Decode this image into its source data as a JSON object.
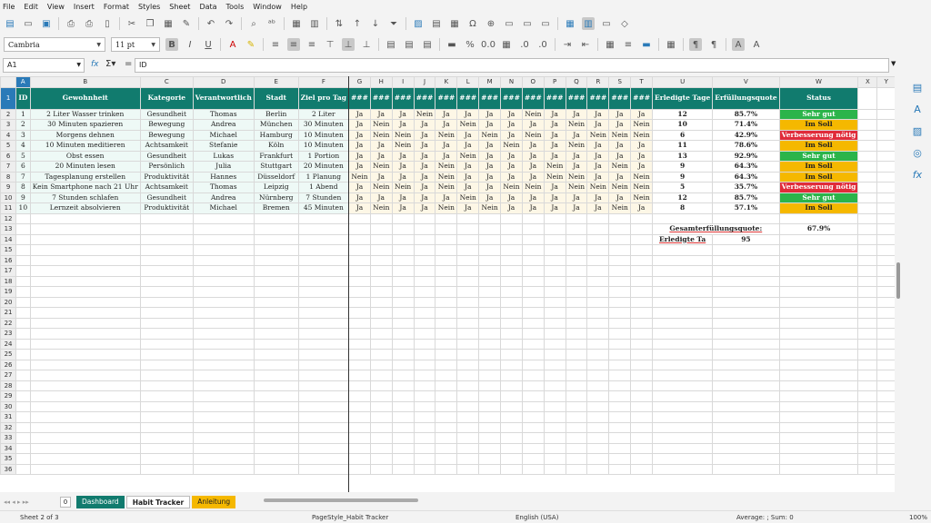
{
  "menu": [
    "File",
    "Edit",
    "View",
    "Insert",
    "Format",
    "Styles",
    "Sheet",
    "Data",
    "Tools",
    "Window",
    "Help"
  ],
  "font_name": "Cambria",
  "font_size": "11 pt",
  "name_box": "A1",
  "formula": "ID",
  "columns": [
    "A",
    "B",
    "C",
    "D",
    "E",
    "F",
    "G",
    "H",
    "I",
    "J",
    "K",
    "L",
    "M",
    "N",
    "O",
    "P",
    "Q",
    "R",
    "S",
    "T",
    "U",
    "V",
    "W",
    "X",
    "Y"
  ],
  "header_row": [
    "ID",
    "Gewohnheit",
    "Kategorie",
    "Verantwortlich",
    "Stadt",
    "Ziel pro Tag",
    "###",
    "###",
    "###",
    "###",
    "###",
    "###",
    "###",
    "###",
    "###",
    "###",
    "###",
    "###",
    "###",
    "###",
    "Erledigte Tage",
    "Erfüllungsquote",
    "Status"
  ],
  "rows": [
    {
      "id": "1",
      "habit": "2 Liter Wasser trinken",
      "cat": "Gesundheit",
      "who": "Thomas",
      "city": "Berlin",
      "goal": "2 Liter",
      "days": [
        "Ja",
        "Ja",
        "Ja",
        "Nein",
        "Ja",
        "Ja",
        "Ja",
        "Ja",
        "Nein",
        "Ja",
        "Ja",
        "Ja",
        "Ja",
        "Ja"
      ],
      "done": "12",
      "rate": "85.7%",
      "status": "Sehr gut",
      "cls": "sg"
    },
    {
      "id": "2",
      "habit": "30 Minuten spazieren",
      "cat": "Bewegung",
      "who": "Andrea",
      "city": "München",
      "goal": "30 Minuten",
      "days": [
        "Ja",
        "Nein",
        "Ja",
        "Ja",
        "Ja",
        "Nein",
        "Ja",
        "Ja",
        "Ja",
        "Ja",
        "Nein",
        "Ja",
        "Ja",
        "Nein"
      ],
      "done": "10",
      "rate": "71.4%",
      "status": "Im Soll",
      "cls": "is"
    },
    {
      "id": "3",
      "habit": "Morgens dehnen",
      "cat": "Bewegung",
      "who": "Michael",
      "city": "Hamburg",
      "goal": "10 Minuten",
      "days": [
        "Ja",
        "Nein",
        "Nein",
        "Ja",
        "Nein",
        "Ja",
        "Nein",
        "Ja",
        "Nein",
        "Ja",
        "Ja",
        "Nein",
        "Nein",
        "Nein"
      ],
      "done": "6",
      "rate": "42.9%",
      "status": "Verbesserung nötig",
      "cls": "vn"
    },
    {
      "id": "4",
      "habit": "10 Minuten meditieren",
      "cat": "Achtsamkeit",
      "who": "Stefanie",
      "city": "Köln",
      "goal": "10 Minuten",
      "days": [
        "Ja",
        "Ja",
        "Nein",
        "Ja",
        "Ja",
        "Ja",
        "Ja",
        "Nein",
        "Ja",
        "Ja",
        "Nein",
        "Ja",
        "Ja",
        "Ja"
      ],
      "done": "11",
      "rate": "78.6%",
      "status": "Im Soll",
      "cls": "is"
    },
    {
      "id": "5",
      "habit": "Obst essen",
      "cat": "Gesundheit",
      "who": "Lukas",
      "city": "Frankfurt",
      "goal": "1 Portion",
      "days": [
        "Ja",
        "Ja",
        "Ja",
        "Ja",
        "Ja",
        "Nein",
        "Ja",
        "Ja",
        "Ja",
        "Ja",
        "Ja",
        "Ja",
        "Ja",
        "Ja"
      ],
      "done": "13",
      "rate": "92.9%",
      "status": "Sehr gut",
      "cls": "sg"
    },
    {
      "id": "6",
      "habit": "20 Minuten lesen",
      "cat": "Persönlich",
      "who": "Julia",
      "city": "Stuttgart",
      "goal": "20 Minuten",
      "days": [
        "Ja",
        "Nein",
        "Ja",
        "Ja",
        "Nein",
        "Ja",
        "Ja",
        "Ja",
        "Ja",
        "Nein",
        "Ja",
        "Ja",
        "Nein",
        "Ja"
      ],
      "done": "9",
      "rate": "64.3%",
      "status": "Im Soll",
      "cls": "is"
    },
    {
      "id": "7",
      "habit": "Tagesplanung erstellen",
      "cat": "Produktivität",
      "who": "Hannes",
      "city": "Düsseldorf",
      "goal": "1 Planung",
      "days": [
        "Nein",
        "Ja",
        "Ja",
        "Ja",
        "Nein",
        "Ja",
        "Ja",
        "Ja",
        "Ja",
        "Nein",
        "Nein",
        "Ja",
        "Ja",
        "Nein"
      ],
      "done": "9",
      "rate": "64.3%",
      "status": "Im Soll",
      "cls": "is"
    },
    {
      "id": "8",
      "habit": "Kein Smartphone nach 21 Uhr",
      "cat": "Achtsamkeit",
      "who": "Thomas",
      "city": "Leipzig",
      "goal": "1 Abend",
      "days": [
        "Ja",
        "Nein",
        "Nein",
        "Ja",
        "Nein",
        "Ja",
        "Ja",
        "Nein",
        "Nein",
        "Ja",
        "Nein",
        "Nein",
        "Nein",
        "Nein"
      ],
      "done": "5",
      "rate": "35.7%",
      "status": "Verbesserung nötig",
      "cls": "vn"
    },
    {
      "id": "9",
      "habit": "7 Stunden schlafen",
      "cat": "Gesundheit",
      "who": "Andrea",
      "city": "Nürnberg",
      "goal": "7 Stunden",
      "days": [
        "Ja",
        "Ja",
        "Ja",
        "Ja",
        "Ja",
        "Nein",
        "Ja",
        "Ja",
        "Ja",
        "Ja",
        "Ja",
        "Ja",
        "Ja",
        "Nein"
      ],
      "done": "12",
      "rate": "85.7%",
      "status": "Sehr gut",
      "cls": "sg"
    },
    {
      "id": "10",
      "habit": "Lernzeit absolvieren",
      "cat": "Produktivität",
      "who": "Michael",
      "city": "Bremen",
      "goal": "45 Minuten",
      "days": [
        "Ja",
        "Nein",
        "Ja",
        "Ja",
        "Nein",
        "Ja",
        "Nein",
        "Ja",
        "Ja",
        "Ja",
        "Ja",
        "Ja",
        "Nein",
        "Ja"
      ],
      "done": "8",
      "rate": "57.1%",
      "status": "Im Soll",
      "cls": "is"
    }
  ],
  "summary": {
    "quote_label": "Gesamterfüllungsquote:",
    "quote_value": "67.9%",
    "done_label": "Erledigte Ta",
    "done_value": "95"
  },
  "tabs": {
    "add": "0",
    "dashboard": "Dashboard",
    "habit": "Habit Tracker",
    "anleitung": "Anleitung"
  },
  "status": {
    "sheet": "Sheet 2 of 3",
    "page_style": "PageStyle_Habit Tracker",
    "language": "English (USA)",
    "sum": "Average: ; Sum: 0",
    "zoom": "100%"
  }
}
